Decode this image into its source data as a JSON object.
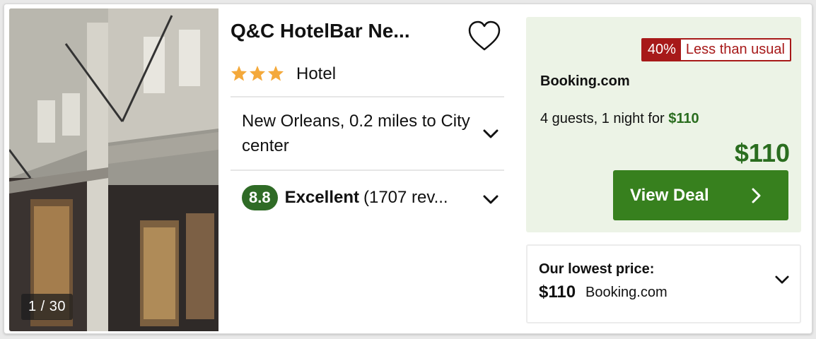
{
  "hotel": {
    "photo_counter": "1 / 30",
    "name": "Q&C HotelBar Ne...",
    "star_count": 3,
    "type": "Hotel",
    "location": "New Orleans, 0.2 miles to City center",
    "rating_score": "8.8",
    "rating_label": "Excellent",
    "reviews": "(1707 rev..."
  },
  "deal": {
    "badge_percent": "40%",
    "badge_text": "Less than usual",
    "provider": "Booking.com",
    "guests_text": "4 guests, 1 night for ",
    "guests_price": "$110",
    "price": "$110",
    "button_label": "View Deal"
  },
  "lowest": {
    "heading": "Our lowest price:",
    "price": "$110",
    "provider": "Booking.com"
  },
  "colors": {
    "accent_green": "#37801e",
    "price_green": "#2a6d1f",
    "badge_red": "#a71919",
    "star_orange": "#f4a93b",
    "deal_bg": "#ecf3e6"
  },
  "icons": [
    "heart-icon",
    "star-icon",
    "chevron-down-icon",
    "chevron-right-icon"
  ]
}
